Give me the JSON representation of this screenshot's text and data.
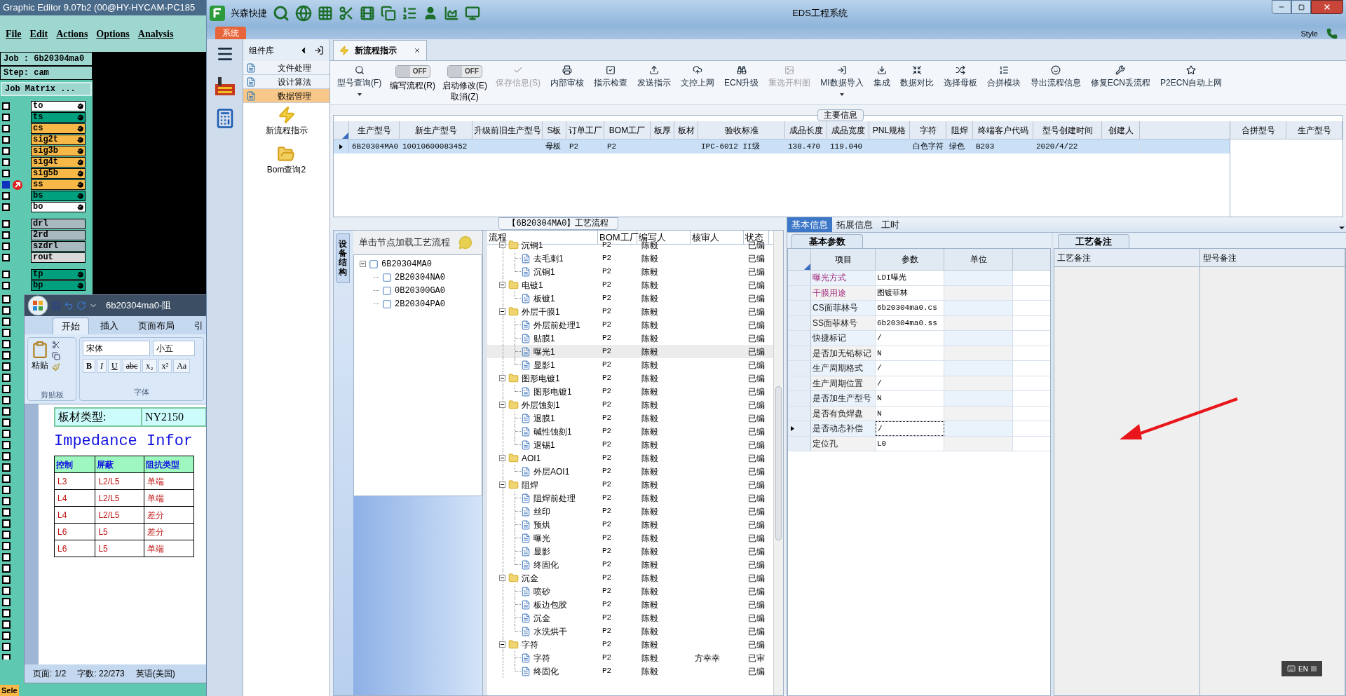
{
  "graphic_editor": {
    "title": "Graphic Editor 9.07b2 (00@HY-HYCAM-PC185",
    "menu": [
      "File",
      "Edit",
      "Actions",
      "Options",
      "Analysis"
    ],
    "job": "Job : 6b20304ma0",
    "step": "Step: cam",
    "job_matrix": "Job Matrix ...",
    "layers": [
      {
        "name": "to",
        "color": "#ffffff",
        "selected": false
      },
      {
        "name": "ts",
        "color": "#00a07e",
        "selected": false
      },
      {
        "name": "cs",
        "color": "#f7b847",
        "selected": false
      },
      {
        "name": "sig2t",
        "color": "#f7b847",
        "selected": false
      },
      {
        "name": "sig3b",
        "color": "#f7b847",
        "selected": false
      },
      {
        "name": "sig4t",
        "color": "#f7b847",
        "selected": false
      },
      {
        "name": "sig5b",
        "color": "#f7b847",
        "selected": false
      },
      {
        "name": "ss",
        "color": "#f7b847",
        "selected": true
      },
      {
        "name": "bs",
        "color": "#00a07e",
        "selected": false
      },
      {
        "name": "bo",
        "color": "#ffffff",
        "selected": false
      },
      {
        "name": "drl",
        "color": "#a9b9c0",
        "selected": false
      },
      {
        "name": "2rd",
        "color": "#a9b9c0",
        "selected": false
      },
      {
        "name": "szdrl",
        "color": "#a9b9c0",
        "selected": false
      },
      {
        "name": "rout",
        "color": "#d9d9d9",
        "selected": false
      },
      {
        "name": "tp",
        "color": "#00a07e",
        "selected": false
      },
      {
        "name": "bp",
        "color": "#00a07e",
        "selected": false
      }
    ],
    "status": "Sele"
  },
  "word": {
    "title": "6b20304ma0-阻",
    "tabs": [
      {
        "label": "开始",
        "selected": true
      },
      {
        "label": "插入",
        "selected": false
      },
      {
        "label": "页面布局",
        "selected": false
      },
      {
        "label": "引",
        "selected": false
      }
    ],
    "paste": "粘贴",
    "font_name": "宋体",
    "font_size": "小五",
    "format_buttons": [
      "B",
      "I",
      "U",
      "abc",
      "x₂",
      "x²",
      "Aa"
    ],
    "groups": [
      "剪贴板",
      "字体"
    ],
    "doc_rows": [
      {
        "label": "板材类型:",
        "value": "NY2150"
      }
    ],
    "heading": "Impedance Infor",
    "impedance_table": {
      "columns": [
        "控制",
        "屏蔽",
        "阻抗类型"
      ],
      "rows": [
        [
          "L3",
          "L2/L5",
          "单端"
        ],
        [
          "L4",
          "L2/L5",
          "单端"
        ],
        [
          "L4",
          "L2/L5",
          "差分"
        ],
        [
          "L6",
          "L5",
          "差分"
        ],
        [
          "L6",
          "L5",
          "单端"
        ]
      ]
    },
    "status": [
      "页面: 1/2",
      "字数: 22/273",
      "英语(美国)"
    ]
  },
  "window": {
    "title": "EDS工程系统",
    "app_name": "兴森快捷",
    "system_tab": "系统",
    "style": "Style"
  },
  "component_library": {
    "title": "组件库",
    "items": [
      {
        "label": "文件处理",
        "selected": false
      },
      {
        "label": "设计算法",
        "selected": false
      },
      {
        "label": "数据管理",
        "selected": true
      }
    ],
    "modules": [
      "新流程指示",
      "Bom查询2"
    ]
  },
  "doc_tab": "新流程指示",
  "toolbar": [
    {
      "kind": "button",
      "label": "型号查询(F)",
      "disabled": false,
      "dropdown": true
    },
    {
      "kind": "toggle",
      "label": "编写流程(R)",
      "state_text": "OFF",
      "on": false
    },
    {
      "kind": "toggle",
      "label": "启动修改(E)",
      "sub_label": "取消(Z)",
      "state_text": "OFF",
      "on": false
    },
    {
      "kind": "button",
      "label": "保存信息(S)",
      "disabled": true,
      "dropdown": false
    },
    {
      "kind": "button",
      "label": "内部审核",
      "disabled": false,
      "dropdown": false
    },
    {
      "kind": "button",
      "label": "指示检查",
      "disabled": false,
      "dropdown": false
    },
    {
      "kind": "button",
      "label": "发送指示",
      "disabled": false,
      "dropdown": false
    },
    {
      "kind": "button",
      "label": "文控上网",
      "disabled": false,
      "dropdown": false
    },
    {
      "kind": "button",
      "label": "ECN升级",
      "disabled": false,
      "dropdown": false
    },
    {
      "kind": "button",
      "label": "重选开料图",
      "disabled": true,
      "dropdown": false
    },
    {
      "kind": "button",
      "label": "MI数据导入",
      "disabled": false,
      "dropdown": true
    },
    {
      "kind": "button",
      "label": "集成",
      "disabled": false,
      "dropdown": false
    },
    {
      "kind": "button",
      "label": "数据对比",
      "disabled": false,
      "dropdown": false
    },
    {
      "kind": "button",
      "label": "选择母板",
      "disabled": false,
      "dropdown": false
    },
    {
      "kind": "button",
      "label": "合拼模块",
      "disabled": false,
      "dropdown": false
    },
    {
      "kind": "button",
      "label": "导出流程信息",
      "disabled": false,
      "dropdown": false
    },
    {
      "kind": "button",
      "label": "修复ECN丢流程",
      "disabled": false,
      "dropdown": false
    },
    {
      "kind": "button",
      "label": "P2ECN自动上网",
      "disabled": false,
      "dropdown": false
    }
  ],
  "main_info": {
    "title": "主要信息",
    "columns": [
      "生产型号",
      "新生产型号",
      "升级前旧生产型号",
      "S板",
      "订单工厂",
      "BOM工厂",
      "板厚",
      "板材",
      "验收标准",
      "成品长度",
      "成品宽度",
      "PNL规格",
      "字符",
      "阻焊",
      "终端客户代码",
      "型号创建时间",
      "创建人"
    ],
    "rows": [
      {
        "selected": true,
        "cells": [
          "6B20304MA0",
          "10010600083452",
          null,
          "母板",
          "P2",
          "P2",
          null,
          null,
          "IPC-6012 II级",
          "138.470",
          "119.040",
          null,
          "白色字符",
          "绿色",
          "B203",
          "2020/4/22",
          null
        ]
      }
    ],
    "side_columns": [
      "合拼型号",
      "生产型号"
    ]
  },
  "process": {
    "title": "【6B20304MA0】工艺流程",
    "side_tab": "设备结构",
    "hint": "单击节点加载工艺流程",
    "tree": [
      {
        "label": "6B20304MA0",
        "expanded": true,
        "children": [
          {
            "label": "2B20304NA0"
          },
          {
            "label": "0B20300GA0"
          },
          {
            "label": "2B20304PA0"
          }
        ]
      }
    ],
    "columns": [
      "流程",
      "BOM工厂",
      "编写人",
      "核审人",
      "状态"
    ],
    "steps": [
      {
        "name": "沉铜1",
        "bom": "P2",
        "writer": "陈毅",
        "status": "已编",
        "selected": false,
        "children": [
          {
            "name": "去毛刺1",
            "bom": "P2",
            "writer": "陈毅",
            "status": "已编",
            "selected": false
          },
          {
            "name": "沉铜1",
            "bom": "P2",
            "writer": "陈毅",
            "status": "已编",
            "selected": false
          }
        ]
      },
      {
        "name": "电镀1",
        "bom": "P2",
        "writer": "陈毅",
        "status": "已编",
        "selected": false,
        "children": [
          {
            "name": "板镀1",
            "bom": "P2",
            "writer": "陈毅",
            "status": "已编",
            "selected": false
          }
        ]
      },
      {
        "name": "外层干膜1",
        "bom": "P2",
        "writer": "陈毅",
        "status": "已编",
        "selected": false,
        "children": [
          {
            "name": "外层前处理1",
            "bom": "P2",
            "writer": "陈毅",
            "status": "已编",
            "selected": false
          },
          {
            "name": "贴膜1",
            "bom": "P2",
            "writer": "陈毅",
            "status": "已编",
            "selected": false
          },
          {
            "name": "曝光1",
            "bom": "P2",
            "writer": "陈毅",
            "status": "已编",
            "selected": true
          },
          {
            "name": "显影1",
            "bom": "P2",
            "writer": "陈毅",
            "status": "已编",
            "selected": false
          }
        ]
      },
      {
        "name": "图形电镀1",
        "bom": "P2",
        "writer": "陈毅",
        "status": "已编",
        "selected": false,
        "children": [
          {
            "name": "图形电镀1",
            "bom": "P2",
            "writer": "陈毅",
            "status": "已编",
            "selected": false
          }
        ]
      },
      {
        "name": "外层蚀刻1",
        "bom": "P2",
        "writer": "陈毅",
        "status": "已编",
        "selected": false,
        "children": [
          {
            "name": "退膜1",
            "bom": "P2",
            "writer": "陈毅",
            "status": "已编",
            "selected": false
          },
          {
            "name": "碱性蚀刻1",
            "bom": "P2",
            "writer": "陈毅",
            "status": "已编",
            "selected": false
          },
          {
            "name": "退锡1",
            "bom": "P2",
            "writer": "陈毅",
            "status": "已编",
            "selected": false
          }
        ]
      },
      {
        "name": "AOI1",
        "bom": "P2",
        "writer": "陈毅",
        "status": "已编",
        "selected": false,
        "children": [
          {
            "name": "外层AOI1",
            "bom": "P2",
            "writer": "陈毅",
            "status": "已编",
            "selected": false
          }
        ]
      },
      {
        "name": "阻焊",
        "bom": "P2",
        "writer": "陈毅",
        "status": "已编",
        "selected": false,
        "children": [
          {
            "name": "阻焊前处理",
            "bom": "P2",
            "writer": "陈毅",
            "status": "已编",
            "selected": false
          },
          {
            "name": "丝印",
            "bom": "P2",
            "writer": "陈毅",
            "status": "已编",
            "selected": false
          },
          {
            "name": "预烘",
            "bom": "P2",
            "writer": "陈毅",
            "status": "已编",
            "selected": false
          },
          {
            "name": "曝光",
            "bom": "P2",
            "writer": "陈毅",
            "status": "已编",
            "selected": false
          },
          {
            "name": "显影",
            "bom": "P2",
            "writer": "陈毅",
            "status": "已编",
            "selected": false
          },
          {
            "name": "终固化",
            "bom": "P2",
            "writer": "陈毅",
            "status": "已编",
            "selected": false
          }
        ]
      },
      {
        "name": "沉金",
        "bom": "P2",
        "writer": "陈毅",
        "status": "已编",
        "selected": false,
        "children": [
          {
            "name": "喷砂",
            "bom": "P2",
            "writer": "陈毅",
            "status": "已编",
            "selected": false
          },
          {
            "name": "板边包胶",
            "bom": "P2",
            "writer": "陈毅",
            "status": "已编",
            "selected": false
          },
          {
            "name": "沉金",
            "bom": "P2",
            "writer": "陈毅",
            "status": "已编",
            "selected": false
          },
          {
            "name": "水洗烘干",
            "bom": "P2",
            "writer": "陈毅",
            "status": "已编",
            "selected": false
          }
        ]
      },
      {
        "name": "字符",
        "bom": "P2",
        "writer": "陈毅",
        "status": "已编",
        "selected": false,
        "children": [
          {
            "name": "字符",
            "bom": "P2",
            "writer": "陈毅",
            "reviewer": "方幸幸",
            "status": "已审",
            "selected": false
          },
          {
            "name": "终固化",
            "bom": "P2",
            "writer": "陈毅",
            "status": "已编",
            "selected": false
          }
        ]
      }
    ]
  },
  "detail_tabs": [
    {
      "label": "基本信息",
      "selected": true
    },
    {
      "label": "拓展信息",
      "selected": false
    },
    {
      "label": "工时",
      "selected": false
    }
  ],
  "basic_params": {
    "tab": "基本参数",
    "columns": [
      "项目",
      "参数",
      "单位"
    ],
    "rows": [
      {
        "item": "曝光方式",
        "value": "LDI曝光",
        "highlight": true,
        "current": false
      },
      {
        "item": "干膜用途",
        "value": "图镀菲林",
        "highlight": true,
        "current": false
      },
      {
        "item": "CS面菲林号",
        "value": "6b20304ma0.cs",
        "highlight": false,
        "current": false
      },
      {
        "item": "SS面菲林号",
        "value": "6b20304ma0.ss",
        "highlight": false,
        "current": false
      },
      {
        "item": "快捷标记",
        "value": "/",
        "highlight": false,
        "current": false
      },
      {
        "item": "是否加无铅标记",
        "value": "N",
        "highlight": false,
        "current": false
      },
      {
        "item": "生产周期格式",
        "value": "/",
        "highlight": false,
        "current": false
      },
      {
        "item": "生产周期位置",
        "value": "/",
        "highlight": false,
        "current": false
      },
      {
        "item": "是否加生产型号",
        "value": "N",
        "highlight": false,
        "current": false
      },
      {
        "item": "是否有负焊盘",
        "value": "N",
        "highlight": false,
        "current": false
      },
      {
        "item": "是否动态补偿",
        "value": "/",
        "highlight": false,
        "current": true
      },
      {
        "item": "定位孔",
        "value": "L0",
        "highlight": false,
        "current": false
      }
    ]
  },
  "remarks": {
    "tab": "工艺备注",
    "columns": [
      "工艺备注",
      "型号备注"
    ]
  },
  "language_bar": "EN"
}
